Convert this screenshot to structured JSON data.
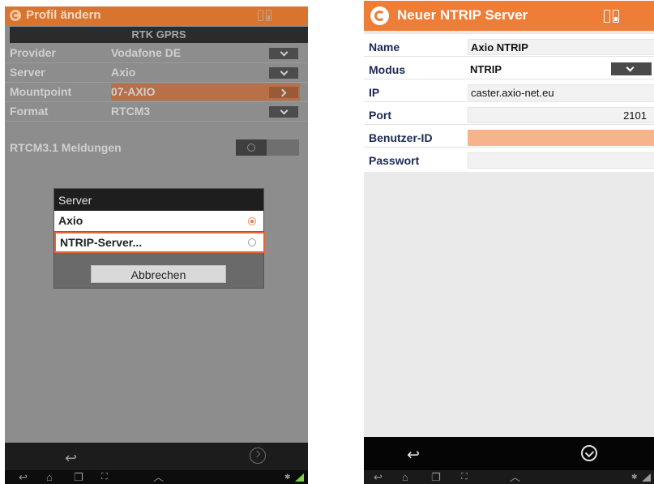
{
  "left_screen": {
    "app_title": "Profil ändern",
    "section_header": "RTK GPRS",
    "rows": [
      {
        "label": "Provider",
        "value": "Vodafone DE"
      },
      {
        "label": "Server",
        "value": "Axio"
      },
      {
        "label": "Mountpoint",
        "value": "07-AXIO"
      },
      {
        "label": "Format",
        "value": "RTCM3"
      }
    ],
    "toggle_row_label": "RTCM3.1 Meldungen",
    "dialog": {
      "title": "Server",
      "options": [
        {
          "label": "Axio",
          "selected": true
        },
        {
          "label": "NTRIP-Server...",
          "selected": false
        }
      ],
      "cancel_label": "Abbrechen"
    }
  },
  "right_screen": {
    "app_title": "Neuer NTRIP Server",
    "fields": [
      {
        "label": "Name",
        "value": "Axio NTRIP"
      },
      {
        "label": "Modus",
        "value": "NTRIP"
      },
      {
        "label": "IP",
        "value": "caster.axio-net.eu"
      },
      {
        "label": "Port",
        "value": "2101"
      },
      {
        "label": "Benutzer-ID",
        "value": ""
      },
      {
        "label": "Passwort",
        "value": ""
      }
    ]
  },
  "colors": {
    "accent_orange": "#ee7d38",
    "left_appbar": "#d9742f",
    "highlight_field": "#f7b48c",
    "label_navy": "#1b2a55"
  },
  "icons": [
    "app-logo-icon",
    "sim-card-icon",
    "chevron-down-icon",
    "chevron-right-icon",
    "radio-icon",
    "back-arrow-icon",
    "check-circle-icon",
    "home-icon",
    "recents-icon",
    "screenshot-icon",
    "up-caret-icon",
    "signal-icon"
  ]
}
